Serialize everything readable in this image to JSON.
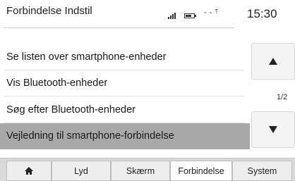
{
  "header": {
    "title": "Forbindelse Indstil",
    "network_status": "- - ᵀ",
    "time": "15:30",
    "icons": [
      "signal-strength-icon",
      "battery-icon"
    ]
  },
  "menu": {
    "items": [
      {
        "label": "Se listen over smartphone-enheder",
        "selected": false
      },
      {
        "label": "Vis Bluetooth-enheder",
        "selected": false
      },
      {
        "label": "Søg efter Bluetooth-enheder",
        "selected": false
      },
      {
        "label": "Vejledning til smartphone-forbindelse",
        "selected": true
      }
    ]
  },
  "scroll": {
    "page_indicator": "1/2",
    "up_icon": "arrow-up-icon",
    "down_icon": "arrow-down-icon"
  },
  "tabs": {
    "home_icon": "home-icon",
    "items": [
      {
        "label": "Lyd",
        "active": false
      },
      {
        "label": "Skærm",
        "active": false
      },
      {
        "label": "Forbindelse",
        "active": true
      },
      {
        "label": "System",
        "active": false
      }
    ]
  },
  "colors": {
    "selected_row": "#a8a8a8",
    "tab_bar": "#d9d9d9",
    "active_tab": "#ffffff"
  }
}
